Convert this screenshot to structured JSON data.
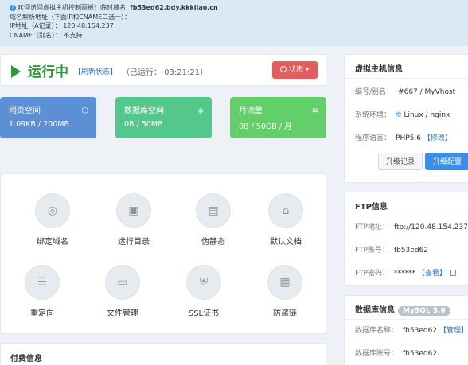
{
  "notice": {
    "line1_prefix": "欢迎访问虚拟主机控制面板！临时域名:",
    "temp_domain": "fb53ed62.bdy.kkkliao.cn",
    "line2": "域名解析地址（下面IP和CNAME二选一）：",
    "line3": "IP地址（A记录）：  120.48.154.237",
    "line4": "CNAME（别名）：  不支持"
  },
  "status": {
    "title": "运行中",
    "refresh": "【刷新状态】",
    "uptime": "（已运行：  03:21:21）",
    "state_button": "状态"
  },
  "metrics": [
    {
      "label": "网页空间",
      "value": "1.09KB / 200MB",
      "icon": "cube-icon"
    },
    {
      "label": "数据库空间",
      "value": "0B / 50MB",
      "icon": "database-icon"
    },
    {
      "label": "月流量",
      "value": "0B / 50GB / 月",
      "icon": "wifi-icon"
    }
  ],
  "tools": [
    {
      "label": "绑定域名",
      "icon": "globe-icon"
    },
    {
      "label": "运行目录",
      "icon": "ssl-folder-icon"
    },
    {
      "label": "伪静态",
      "icon": "document-edit-icon"
    },
    {
      "label": "默认文档",
      "icon": "home-icon"
    },
    {
      "label": "重定向",
      "icon": "sliders-icon"
    },
    {
      "label": "文件管理",
      "icon": "folder-icon"
    },
    {
      "label": "SSL证书",
      "icon": "ssl-certificate-icon"
    },
    {
      "label": "防盗链",
      "icon": "anti-leech-icon"
    }
  ],
  "pay": {
    "title": "付费信息"
  },
  "vhost": {
    "title": "虚拟主机信息",
    "id_label": "编号/别名：",
    "id_value": "#667 / MyVhost",
    "env_label": "系统环境：",
    "env_value": "Linux / nginx",
    "lang_label": "程序语言：",
    "lang_value": "PHP5.6",
    "lang_edit": "【修改】",
    "upgrade_log": "升级记录",
    "upgrade_config": "升级配置"
  },
  "ftp": {
    "title": "FTP信息",
    "addr_label": "FTP地址：",
    "addr_value": "ftp://120.48.154.237",
    "user_label": "FTP账号：",
    "user_value": "fb53ed62",
    "pass_label": "FTP密码：",
    "pass_value": "******",
    "pass_view": "【查看】"
  },
  "db": {
    "title": "数据库信息",
    "badge": "MySQL 5.6",
    "name_label": "数据库名称：",
    "name_value": "fb53ed62",
    "name_manage": "【管理】",
    "user_label": "数据库账号：",
    "user_value": "fb53ed62"
  },
  "colors": {
    "accent": "#3a8ee6",
    "running": "#2e9a3e",
    "state_button": "#e55c5c",
    "web_space": "#5b8fd6",
    "db_space": "#52c98a",
    "traffic": "#62cf6a"
  }
}
